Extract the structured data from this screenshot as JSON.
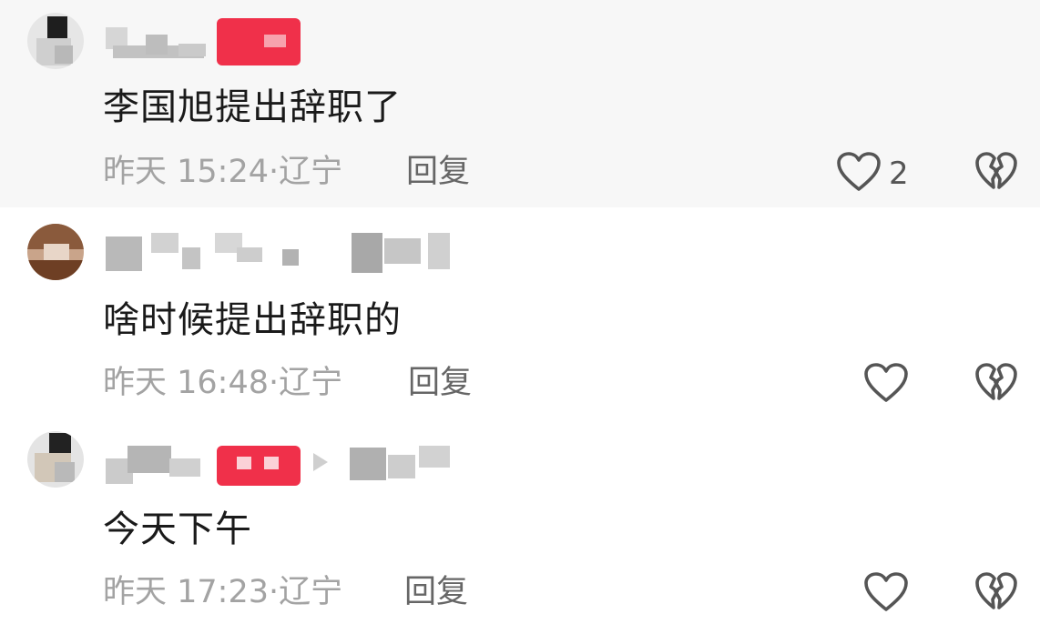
{
  "comments": [
    {
      "text": "李国旭提出辞职了",
      "time": "昨天 15:24",
      "sep": "·",
      "location": "辽宁",
      "reply_label": "回复",
      "like_count": "2",
      "like_icon": "heart-outline-icon",
      "dislike_icon": "broken-heart-icon"
    },
    {
      "text": "啥时候提出辞职的",
      "time": "昨天 16:48",
      "sep": "·",
      "location": "辽宁",
      "reply_label": "回复",
      "like_count": "",
      "like_icon": "heart-outline-icon",
      "dislike_icon": "broken-heart-icon"
    },
    {
      "text": "今天下午",
      "time": "昨天 17:23",
      "sep": "·",
      "location": "辽宁",
      "reply_label": "回复",
      "like_count": "",
      "like_icon": "heart-outline-icon",
      "dislike_icon": "broken-heart-icon"
    }
  ],
  "colors": {
    "highlight_bg": "#f7f7f7",
    "text": "#1a1a1a",
    "meta": "#a3a3a3",
    "badge_red": "#f0304a"
  }
}
